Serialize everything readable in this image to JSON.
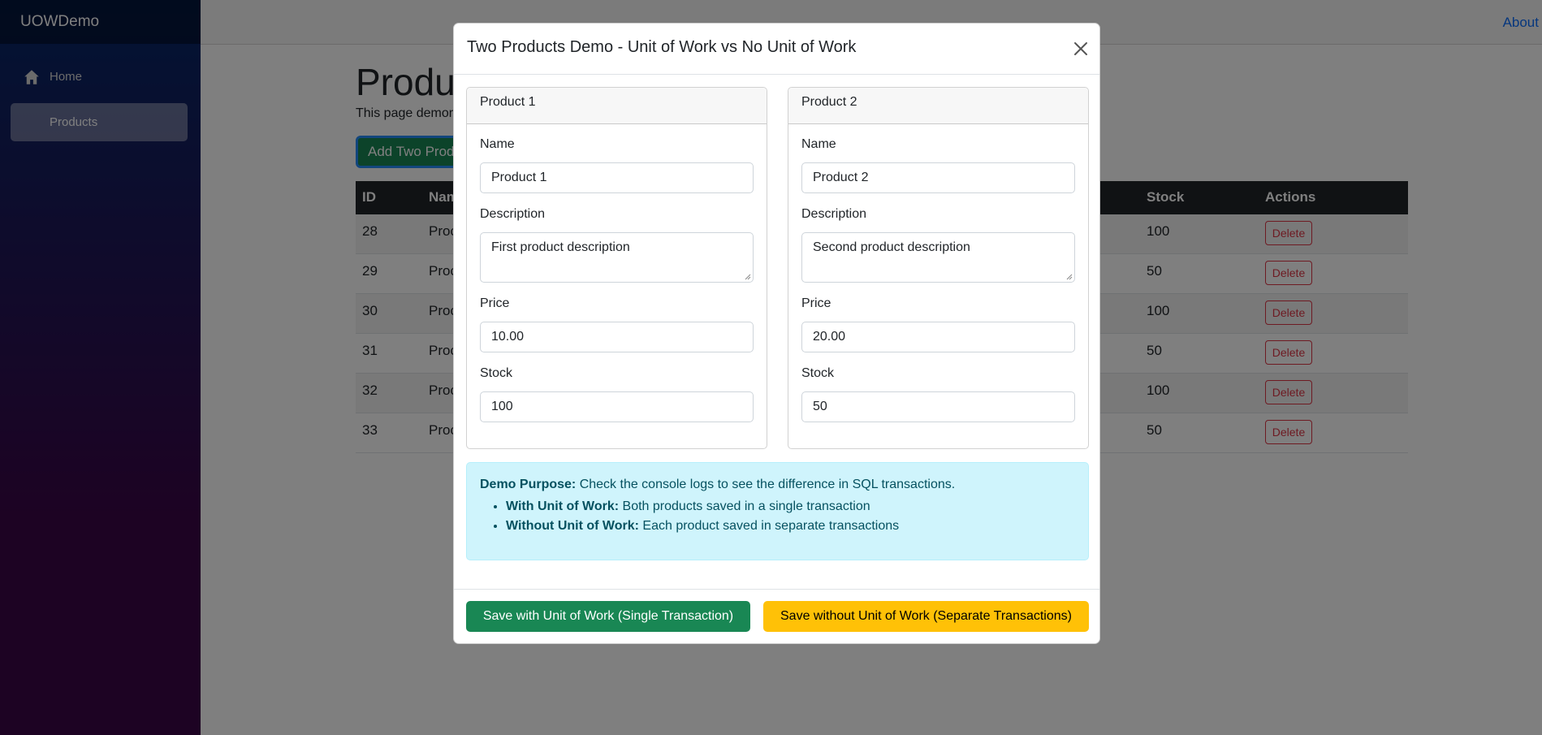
{
  "app": {
    "brand": "UOWDemo",
    "about": "About"
  },
  "sidebar": {
    "items": [
      {
        "label": "Home",
        "icon": "home-icon"
      },
      {
        "label": "Products"
      }
    ]
  },
  "page": {
    "title": "Produc",
    "description": "This page demor",
    "add_button": "Add Two Produ"
  },
  "table": {
    "headers": [
      "ID",
      "Nam",
      "Stock",
      "Actions"
    ],
    "rows": [
      {
        "id": "28",
        "name": "Proc",
        "stock": "100",
        "action": "Delete"
      },
      {
        "id": "29",
        "name": "Proc",
        "stock": "50",
        "action": "Delete"
      },
      {
        "id": "30",
        "name": "Proc",
        "stock": "100",
        "action": "Delete"
      },
      {
        "id": "31",
        "name": "Proc",
        "stock": "50",
        "action": "Delete"
      },
      {
        "id": "32",
        "name": "Proc",
        "stock": "100",
        "action": "Delete"
      },
      {
        "id": "33",
        "name": "Proc",
        "stock": "50",
        "action": "Delete"
      }
    ]
  },
  "modal": {
    "title": "Two Products Demo - Unit of Work vs No Unit of Work",
    "products": [
      {
        "header": "Product 1",
        "name_label": "Name",
        "name": "Product 1",
        "description_label": "Description",
        "description": "First product description",
        "price_label": "Price",
        "price": "10.00",
        "stock_label": "Stock",
        "stock": "100"
      },
      {
        "header": "Product 2",
        "name_label": "Name",
        "name": "Product 2",
        "description_label": "Description",
        "description": "Second product description",
        "price_label": "Price",
        "price": "20.00",
        "stock_label": "Stock",
        "stock": "50"
      }
    ],
    "info": {
      "purpose_label": "Demo Purpose:",
      "purpose_text": " Check the console logs to see the difference in SQL transactions.",
      "with_label": "With Unit of Work:",
      "with_text": " Both products saved in a single transaction",
      "without_label": "Without Unit of Work:",
      "without_text": " Each product saved in separate transactions"
    },
    "save_uow": "Save with Unit of Work (Single Transaction)",
    "save_no_uow": "Save without Unit of Work (Separate Transactions)"
  },
  "colors": {
    "success": "#198754",
    "warning": "#ffc107",
    "danger": "#dc3545",
    "info_bg": "#cff4fc",
    "link": "#0d6efd"
  }
}
